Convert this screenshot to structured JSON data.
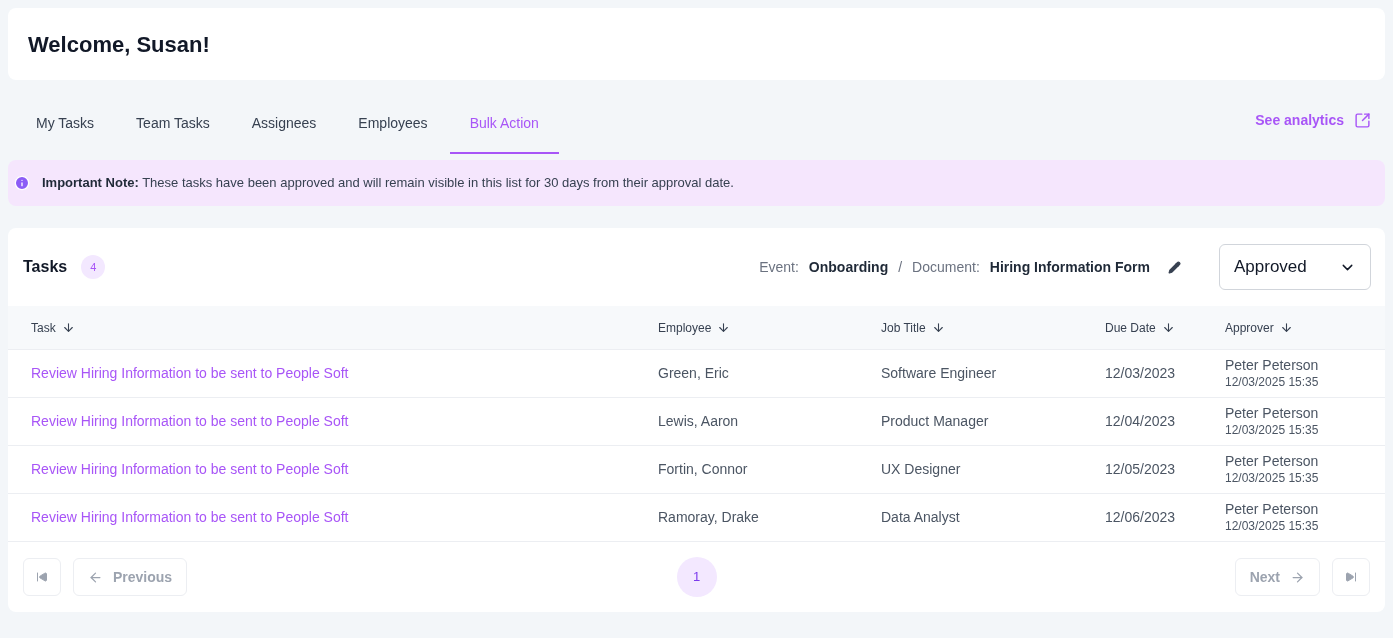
{
  "header": {
    "title": "Welcome, Susan!"
  },
  "tabs": [
    {
      "label": "My Tasks",
      "selected": false
    },
    {
      "label": "Team Tasks",
      "selected": false
    },
    {
      "label": "Assignees",
      "selected": false
    },
    {
      "label": "Employees",
      "selected": false
    },
    {
      "label": "Bulk Action",
      "selected": true
    }
  ],
  "analytics_link": "See analytics",
  "note": "**Important Note:** These tasks have been approved and will remain visible in this list for 30 days from their approval date.",
  "tasks": {
    "title": "Tasks",
    "count": "4",
    "event_label": "Event:",
    "event": "Onboarding",
    "separator": "/",
    "document_label": "Document:",
    "document": "Hiring Information Form",
    "status_select": "Approved",
    "columns": [
      "Task",
      "Employee",
      "Job Title",
      "Due Date",
      "Approver"
    ],
    "rows": [
      {
        "task": "Review Hiring Information to be sent to People Soft",
        "employee": "Green, Eric",
        "job_title": "Software Engineer",
        "due_date": "12/03/2023",
        "approver": "Peter Peterson",
        "approved_at": "12/03/2025 15:35"
      },
      {
        "task": "Review Hiring Information to be sent to People Soft",
        "employee": "Lewis, Aaron",
        "job_title": "Product Manager",
        "due_date": "12/04/2023",
        "approver": "Peter Peterson",
        "approved_at": "12/03/2025 15:35"
      },
      {
        "task": "Review Hiring Information to be sent to People Soft",
        "employee": "Fortin, Connor",
        "job_title": "UX Designer",
        "due_date": "12/05/2023",
        "approver": "Peter Peterson",
        "approved_at": "12/03/2025 15:35"
      },
      {
        "task": "Review Hiring Information to be sent to People Soft",
        "employee": "Ramoray, Drake",
        "job_title": "Data Analyst",
        "due_date": "12/06/2023",
        "approver": "Peter Peterson",
        "approved_at": "12/03/2025 15:35"
      }
    ]
  },
  "pagination": {
    "first": {
      "disabled": true
    },
    "previous": {
      "label": "Previous",
      "disabled": true
    },
    "pages": [
      {
        "label": "1",
        "selected": true
      }
    ],
    "next": {
      "label": "Next",
      "disabled": true
    },
    "last": {
      "disabled": true
    }
  }
}
